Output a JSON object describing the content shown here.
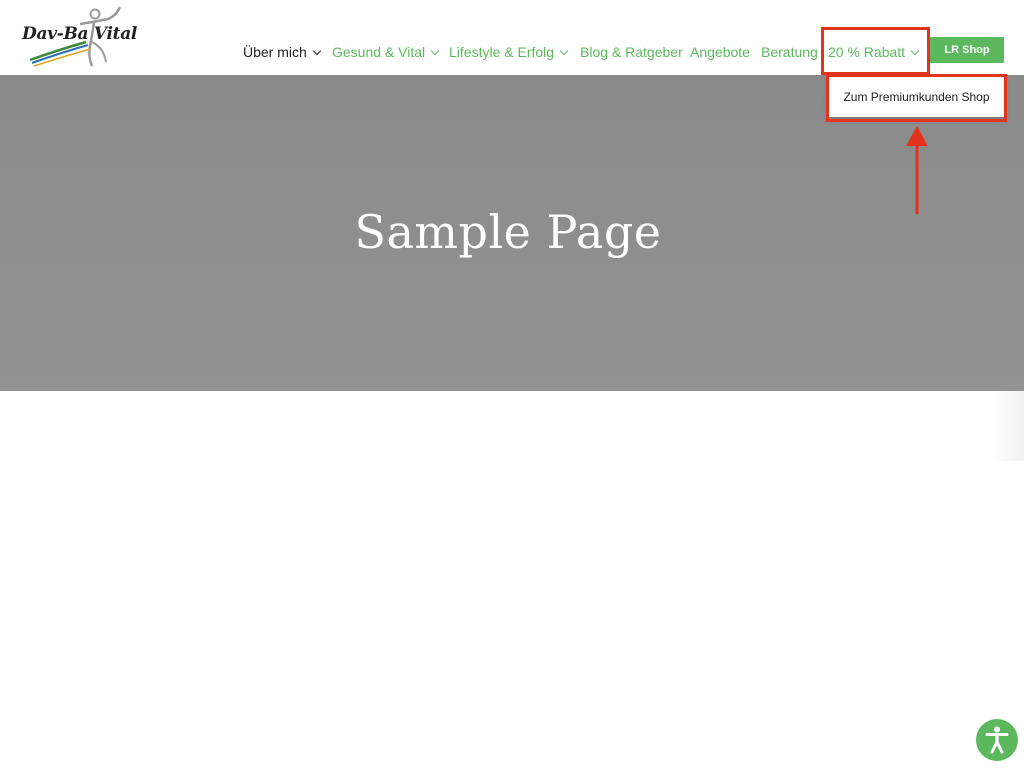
{
  "logo": {
    "text": "Dav-Ba Vital"
  },
  "nav": {
    "items": [
      {
        "label": "Über mich",
        "dropdown": true
      },
      {
        "label": "Gesund & Vital",
        "dropdown": true
      },
      {
        "label": "Lifestyle & Erfolg",
        "dropdown": true
      },
      {
        "label": "Blog & Ratgeber",
        "dropdown": false
      },
      {
        "label": "Angebote",
        "dropdown": false
      },
      {
        "label": "Beratung",
        "dropdown": false
      },
      {
        "label": "20 % Rabatt",
        "dropdown": true
      }
    ],
    "shop_button": "LR Shop"
  },
  "dropdown": {
    "items": [
      {
        "label": "Zum Premiumkunden Shop"
      }
    ]
  },
  "hero": {
    "title": "Sample Page"
  },
  "colors": {
    "brand_green": "#5cb85c",
    "hero_gray": "#8e8e8e",
    "annotation_red": "#e2341d"
  },
  "icons": {
    "logo": "dancing-figure-icon",
    "chevron": "chevron-down-icon",
    "accessibility": "accessibility-icon",
    "annotation_arrow": "arrow-up-icon"
  }
}
